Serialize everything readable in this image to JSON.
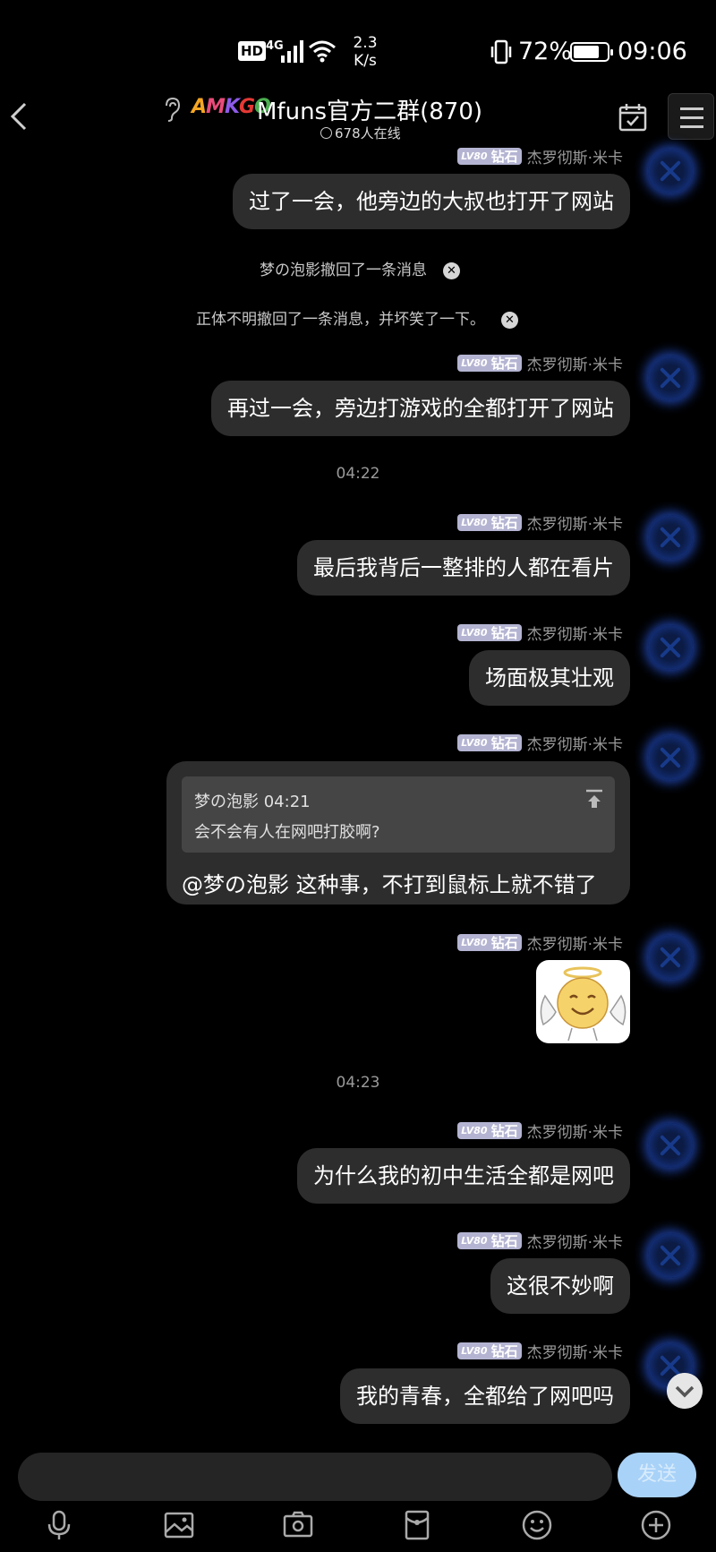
{
  "status_bar": {
    "hd": "HD",
    "network": "4G",
    "speed_value": "2.3",
    "speed_unit": "K/s",
    "battery_percent": "72%",
    "time": "09:06"
  },
  "header": {
    "logo_letters": [
      "A",
      "M",
      "K",
      "G",
      "O",
      ""
    ],
    "title": "Mfuns官方二群(870)",
    "online": "678人在线"
  },
  "system_notices": [
    {
      "text": "梦の泡影撤回了一条消息"
    },
    {
      "text": "正体不明撤回了一条消息，并坏笑了一下。"
    }
  ],
  "time_dividers": [
    "04:22",
    "04:23"
  ],
  "sender": {
    "lv": "LV80",
    "tier": "钻石",
    "name": "杰罗彻斯·米卡"
  },
  "messages": [
    {
      "text": "过了一会，他旁边的大叔也打开了网站"
    },
    {
      "text": "再过一会，旁边打游戏的全都打开了网站"
    },
    {
      "text": "最后我背后一整排的人都在看片"
    },
    {
      "text": "场面极其壮观"
    },
    {
      "quote_sender": "梦の泡影",
      "quote_time": "04:21",
      "quote_text": "会不会有人在网吧打胶啊?",
      "text": "@梦の泡影 这种事，不打到鼠标上就不错了"
    },
    {
      "type": "sticker",
      "sticker": "angel-smiley-sticker"
    },
    {
      "text": "为什么我的初中生活全都是网吧"
    },
    {
      "text": "这很不妙啊"
    },
    {
      "text": "我的青春，全都给了网吧吗"
    }
  ],
  "input": {
    "send_label": "发送"
  },
  "toolbar": [
    "microphone-icon",
    "image-icon",
    "camera-icon",
    "red-packet-icon",
    "emoji-icon",
    "plus-icon"
  ],
  "colors": {
    "background": "#000000",
    "bubble": "#2d2d2d",
    "badge": "#b4b4d2",
    "send_button": "#a9d2f8",
    "avatar_glow": "#1d3f9e"
  }
}
